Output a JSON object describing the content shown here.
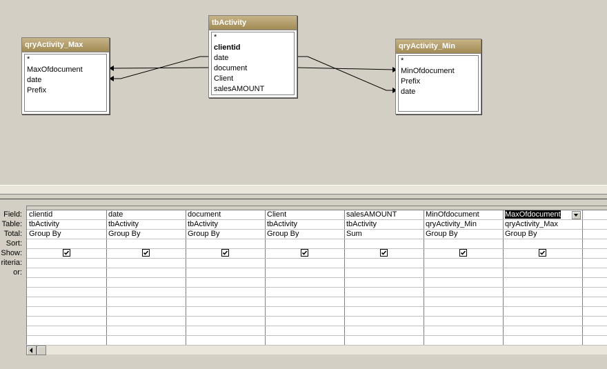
{
  "tables": [
    {
      "key": "max",
      "title": "qryActivity_Max",
      "fields": [
        "*",
        "MaxOfdocument",
        "date",
        "Prefix"
      ],
      "bold": []
    },
    {
      "key": "act",
      "title": "tbActivity",
      "fields": [
        "*",
        "clientid",
        "date",
        "document",
        "Client",
        "salesAMOUNT"
      ],
      "bold": [
        1
      ]
    },
    {
      "key": "min",
      "title": "qryActivity_Min",
      "fields": [
        "*",
        "MinOfdocument",
        "Prefix",
        "date"
      ],
      "bold": []
    }
  ],
  "row_labels": [
    "Field:",
    "Table:",
    "Total:",
    "Sort:",
    "Show:",
    "riteria:",
    "or:"
  ],
  "columns": [
    {
      "field": "clientid",
      "table": "tbActivity",
      "total": "Group By",
      "sort": "",
      "show": true
    },
    {
      "field": "date",
      "table": "tbActivity",
      "total": "Group By",
      "sort": "",
      "show": true
    },
    {
      "field": "document",
      "table": "tbActivity",
      "total": "Group By",
      "sort": "",
      "show": true
    },
    {
      "field": "Client",
      "table": "tbActivity",
      "total": "Group By",
      "sort": "",
      "show": true
    },
    {
      "field": "salesAMOUNT",
      "table": "tbActivity",
      "total": "Sum",
      "sort": "",
      "show": true
    },
    {
      "field": "MinOfdocument",
      "table": "qryActivity_Min",
      "total": "Group By",
      "sort": "",
      "show": true
    },
    {
      "field": "MaxOfdocument",
      "table": "qryActivity_Max",
      "total": "Group By",
      "sort": "",
      "show": true,
      "selected": true
    }
  ]
}
